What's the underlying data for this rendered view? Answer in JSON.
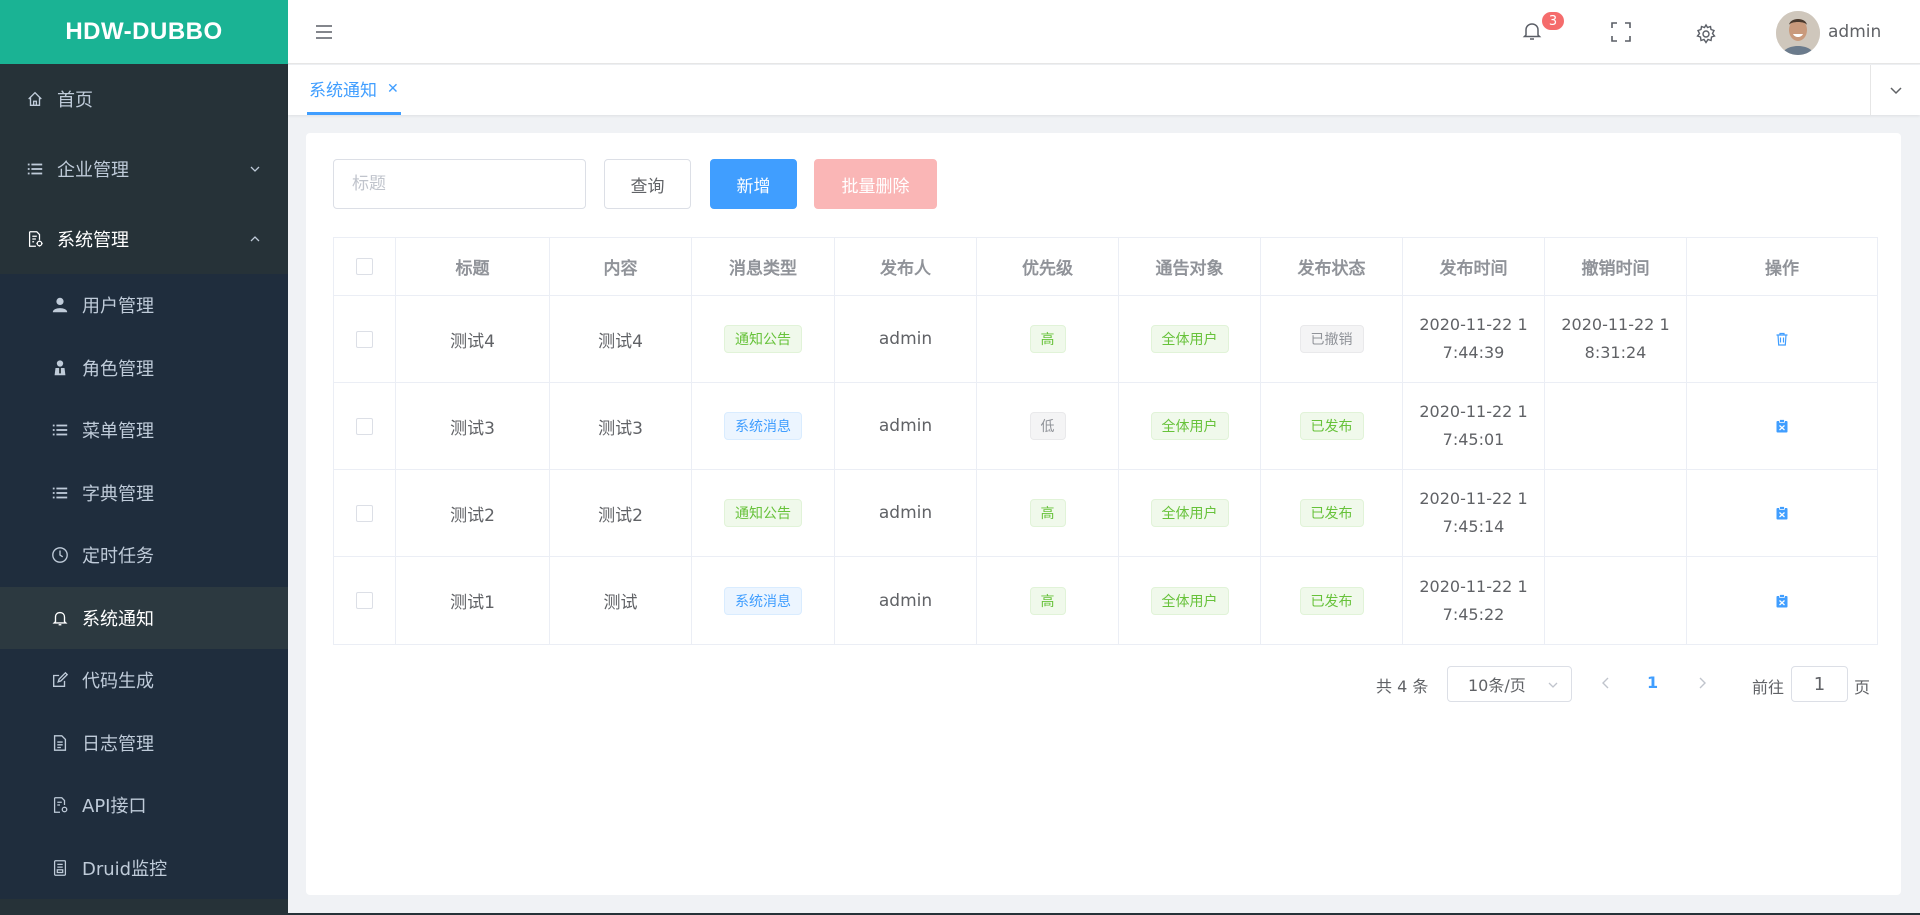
{
  "app": {
    "logo": "HDW-DUBBO"
  },
  "sidebar": {
    "items": [
      {
        "label": "首页",
        "icon": "home-icon"
      },
      {
        "label": "企业管理",
        "icon": "list-icon",
        "expanded": false
      },
      {
        "label": "系统管理",
        "icon": "document-settings-icon",
        "expanded": true
      }
    ],
    "sub_items": [
      {
        "label": "用户管理",
        "icon": "user-icon"
      },
      {
        "label": "角色管理",
        "icon": "role-icon"
      },
      {
        "label": "菜单管理",
        "icon": "list-icon"
      },
      {
        "label": "字典管理",
        "icon": "list-icon"
      },
      {
        "label": "定时任务",
        "icon": "clock-icon"
      },
      {
        "label": "系统通知",
        "icon": "bell-icon",
        "active": true
      },
      {
        "label": "代码生成",
        "icon": "edit-icon"
      },
      {
        "label": "日志管理",
        "icon": "document-icon"
      },
      {
        "label": "API接口",
        "icon": "api-doc-icon"
      },
      {
        "label": "Druid监控",
        "icon": "monitor-icon"
      }
    ]
  },
  "header": {
    "notification_count": "3",
    "username": "admin"
  },
  "tabs": [
    {
      "label": "系统通知",
      "active": true
    }
  ],
  "toolbar": {
    "search_placeholder": "标题",
    "query_label": "查询",
    "add_label": "新增",
    "batch_delete_label": "批量删除"
  },
  "table": {
    "columns": [
      "标题",
      "内容",
      "消息类型",
      "发布人",
      "优先级",
      "通告对象",
      "发布状态",
      "发布时间",
      "撤销时间",
      "操作"
    ],
    "rows": [
      {
        "title": "测试4",
        "content": "测试4",
        "type": "通知公告",
        "type_style": "success",
        "publisher": "admin",
        "priority": "高",
        "priority_style": "success",
        "target": "全体用户",
        "status": "已撤销",
        "status_style": "info",
        "publish_time": "2020-11-22 17:44:39",
        "revoke_time": "2020-11-22 18:31:24",
        "op_icon": "trash-icon"
      },
      {
        "title": "测试3",
        "content": "测试3",
        "type": "系统消息",
        "type_style": "primary",
        "publisher": "admin",
        "priority": "低",
        "priority_style": "info",
        "target": "全体用户",
        "status": "已发布",
        "status_style": "success",
        "publish_time": "2020-11-22 17:45:01",
        "revoke_time": "",
        "op_icon": "revoke-icon"
      },
      {
        "title": "测试2",
        "content": "测试2",
        "type": "通知公告",
        "type_style": "success",
        "publisher": "admin",
        "priority": "高",
        "priority_style": "success",
        "target": "全体用户",
        "status": "已发布",
        "status_style": "success",
        "publish_time": "2020-11-22 17:45:14",
        "revoke_time": "",
        "op_icon": "revoke-icon"
      },
      {
        "title": "测试1",
        "content": "测试",
        "type": "系统消息",
        "type_style": "primary",
        "publisher": "admin",
        "priority": "高",
        "priority_style": "success",
        "target": "全体用户",
        "status": "已发布",
        "status_style": "success",
        "publish_time": "2020-11-22 17:45:22",
        "revoke_time": "",
        "op_icon": "revoke-icon"
      }
    ]
  },
  "pagination": {
    "total": "共 4 条",
    "page_size": "10条/页",
    "current_page": "1",
    "goto_label": "前往",
    "goto_value": "1",
    "page_suffix": "页"
  },
  "colors": {
    "primary": "#409eff",
    "brand": "#1ab394",
    "sidebar_bg": "#263238",
    "danger": "#f56c6c"
  }
}
